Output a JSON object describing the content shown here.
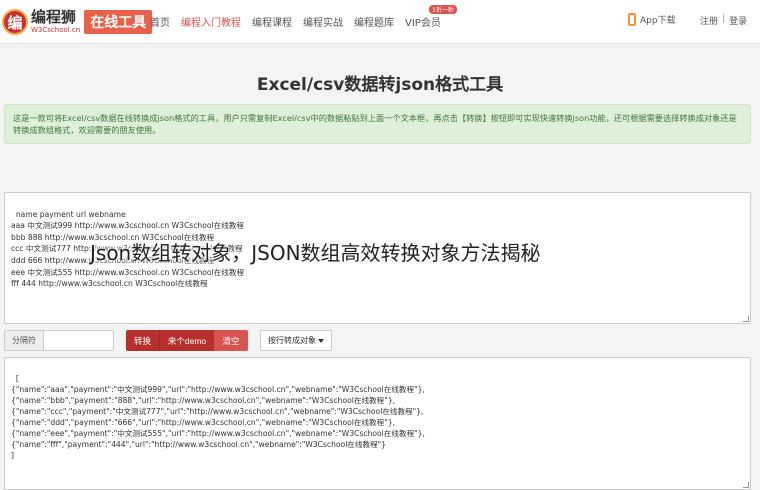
{
  "header": {
    "logo_icon": "编",
    "logo_name": "编程狮",
    "logo_sub": "W3Cschool.cn",
    "logo_badge": "在线工具",
    "nav": [
      {
        "label": "首页",
        "active": false
      },
      {
        "label": "编程入门教程",
        "active": true
      },
      {
        "label": "编程课程",
        "active": false
      },
      {
        "label": "编程实战",
        "active": false
      },
      {
        "label": "编程题库",
        "active": false
      },
      {
        "label": "VIP会员",
        "active": false
      }
    ],
    "vip_badge": "1折一秒",
    "app_download": "App下载",
    "register": "注册",
    "login": "登录",
    "auth_sep": "|"
  },
  "page_title": "Excel/csv数据转json格式工具",
  "notice": "这是一款可将Excel/csv数据在线转换成json格式的工具，用户只需复制Excel/csv中的数据粘贴到上面一个文本框，再点击【转换】按钮即可实现快速转换json功能，还可根据需要选择转换成对象还是转换成数组格式，欢迎需要的朋友使用。",
  "input_text": "name payment url webname\naaa 中文测试999 http://www.w3cschool.cn W3Cschool在线教程\nbbb 888 http://www.w3cschool.cn W3Cschool在线教程\nccc 中文测试777 http://www.w3cschool.cn W3Cschool在线教程\nddd 666 http://www.w3cschool.cn W3Cschool在线教程\neee 中文测试555 http://www.w3cschool.cn W3Cschool在线教程\nfff 444 http://www.w3cschool.cn W3Cschool在线教程",
  "controls": {
    "delimiter_label": "分隔符",
    "delimiter_value": "",
    "convert_label": "转换",
    "demo_label": "来个demo",
    "clear_label": "清空",
    "mode_label": "按行转成对象"
  },
  "output_text": "[\n{\"name\":\"aaa\",\"payment\":\"中文测试999\",\"url\":\"http://www.w3cschool.cn\",\"webname\":\"W3Cschool在线教程\"},\n{\"name\":\"bbb\",\"payment\":\"888\",\"url\":\"http://www.w3cschool.cn\",\"webname\":\"W3Cschool在线教程\"},\n{\"name\":\"ccc\",\"payment\":\"中文测试777\",\"url\":\"http://www.w3cschool.cn\",\"webname\":\"W3Cschool在线教程\"},\n{\"name\":\"ddd\",\"payment\":\"666\",\"url\":\"http://www.w3cschool.cn\",\"webname\":\"W3Cschool在线教程\"},\n{\"name\":\"eee\",\"payment\":\"中文测试555\",\"url\":\"http://www.w3cschool.cn\",\"webname\":\"W3Cschool在线教程\"},\n{\"name\":\"fff\",\"payment\":\"444\",\"url\":\"http://www.w3cschool.cn\",\"webname\":\"W3Cschool在线教程\"}\n]",
  "overlay_caption": "Json数组转对象，JSON数组高效转换对象方法揭秘",
  "colors": {
    "brand_red": "#d9534f",
    "button_dark_red": "#b8302b",
    "notice_bg": "#dff0d8",
    "notice_text": "#3c763d",
    "app_orange": "#f0963a"
  },
  "icons": {
    "phone": "phone-icon",
    "caret": "caret-down-icon"
  }
}
